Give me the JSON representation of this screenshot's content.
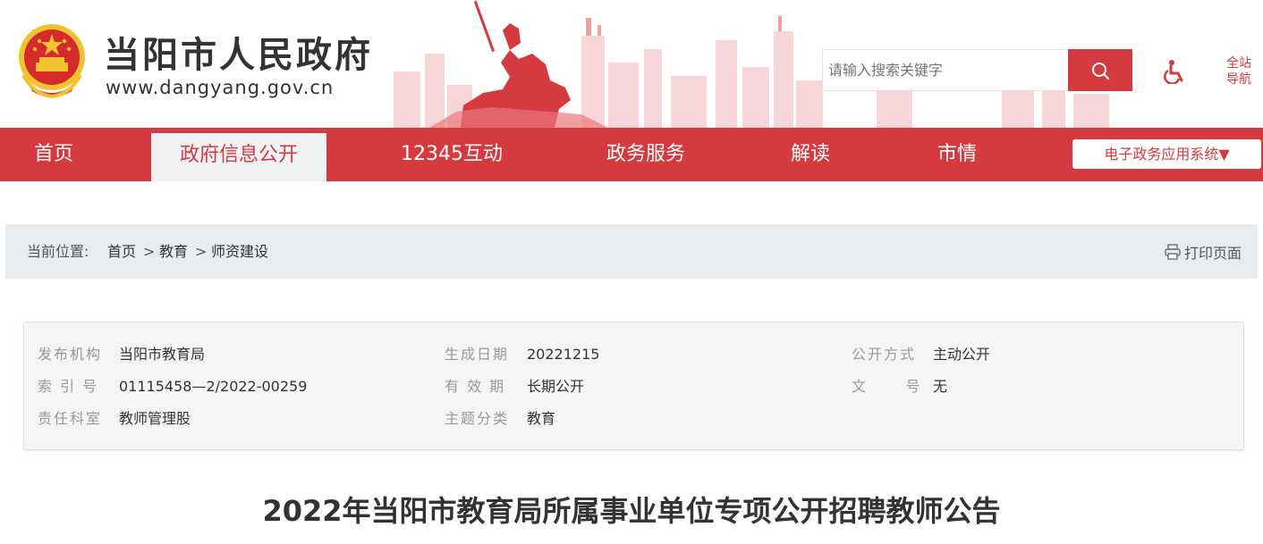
{
  "header": {
    "site_title": "当阳市人民政府",
    "site_url": "www.dangyang.gov.cn",
    "search_placeholder": "请输入搜索关键字",
    "fullnav_line1": "全站",
    "fullnav_line2": "导航"
  },
  "nav": {
    "items": [
      "首页",
      "政府信息公开",
      "12345互动",
      "政务服务",
      "解读",
      "市情"
    ],
    "active": "政府信息公开",
    "system_button": "电子政务应用系统▼"
  },
  "breadcrumb": {
    "prefix": "当前位置:",
    "items": [
      "首页",
      "教育",
      "师资建设"
    ],
    "separator": ">",
    "print_label": "打印页面"
  },
  "meta": {
    "publisher_label": "发布机构",
    "publisher": "当阳市教育局",
    "index_label": "索 引 号",
    "index": "01115458—2/2022-00259",
    "dept_label": "责任科室",
    "dept": "教师管理股",
    "date_label": "生成日期",
    "date": "20221215",
    "validity_label": "有 效 期",
    "validity": "长期公开",
    "topic_label": "主题分类",
    "topic": "教育",
    "open_label": "公开方式",
    "open_mode": "主动公开",
    "docno_label": "文      号",
    "docno": "无"
  },
  "article": {
    "title": "2022年当阳市教育局所属事业单位专项公开招聘教师公告"
  },
  "colors": {
    "brand_red": "#d53a41",
    "breadcrumb_bg": "#e9ecef",
    "meta_bg": "#f5f5f5"
  },
  "icons": [
    "national-emblem-icon",
    "search-icon",
    "accessibility-icon",
    "printer-icon"
  ]
}
